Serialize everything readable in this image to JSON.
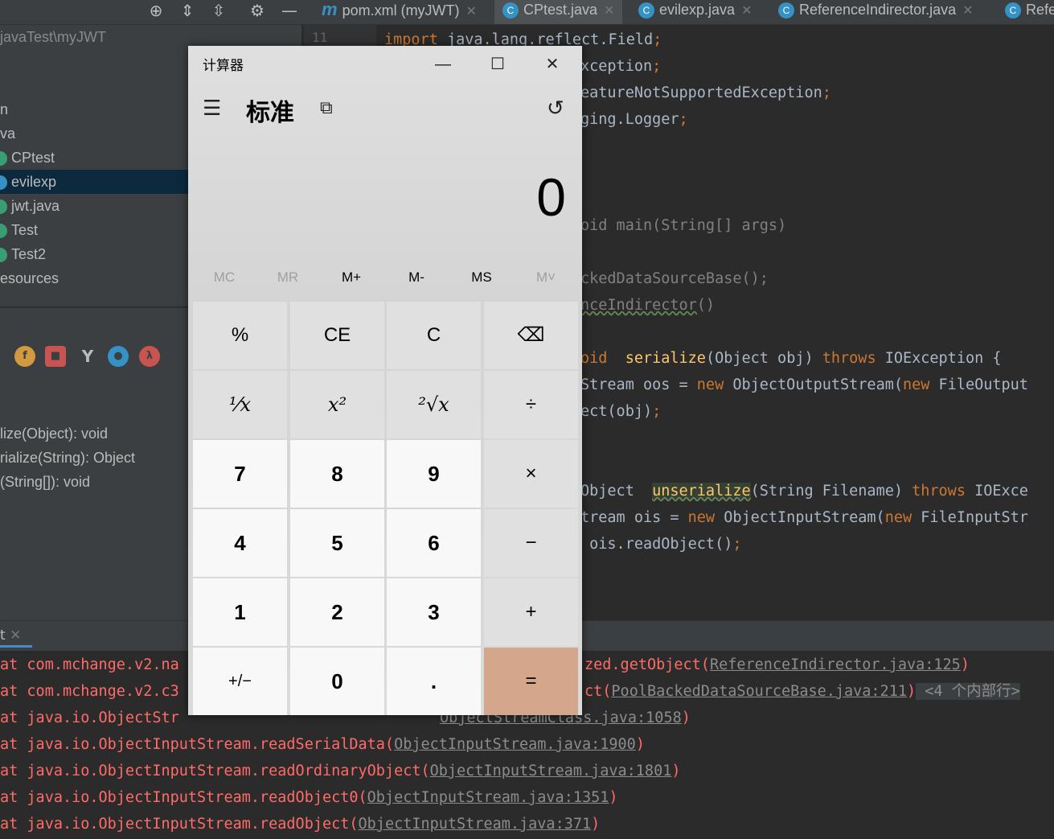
{
  "toolbar": {
    "icons": [
      "target-icon",
      "collapse-icon",
      "expand-icon",
      "gear-icon",
      "minimize-icon"
    ],
    "tabs": [
      {
        "label": "pom.xml (myJWT)",
        "icon": "m"
      },
      {
        "label": "CPtest.java",
        "icon": "C"
      },
      {
        "label": "evilexp.java",
        "icon": "C"
      },
      {
        "label": "ReferenceIndirector.java",
        "icon": "C"
      },
      {
        "label": "Refe",
        "icon": "C"
      }
    ]
  },
  "project": {
    "path": "javaTest\\myJWT",
    "items": [
      "n",
      "va",
      "CPtest",
      "evilexp",
      "jwt.java",
      "Test",
      "Test2",
      "esources"
    ]
  },
  "structure": {
    "items": [
      "lize(Object): void",
      "rialize(String): Object",
      "(String[]): void"
    ]
  },
  "editor": {
    "line_number": "11",
    "lines": [
      "import java.lang.reflect.Field;",
      "xception;",
      "eatureNotSupportedException;",
      "ging.Logger;",
      "",
      "",
      "oid main(String[] args)",
      "",
      "ckedDataSourceBase();",
      "nceIndirector()",
      "",
      "oid  serialize(Object obj) throws IOException {",
      "Stream oos = new ObjectOutputStream(new FileOutput",
      "ect(obj);",
      "",
      "",
      "Object  unserialize(String Filename) throws IOExce",
      "tream ois = new ObjectInputStream(new FileInputStr",
      " ois.readObject();"
    ]
  },
  "console": {
    "tab": "t",
    "lines": [
      {
        "pre": "at com.mchange.v2.na",
        "mid": "zed.getObject(",
        "link": "ReferenceIndirector.java:125",
        "post": ")"
      },
      {
        "pre": "at com.mchange.v2.c3",
        "mid": "ct(",
        "link": "PoolBackedDataSourceBase.java:211",
        "post": ")",
        "extra": " <4 个内部行>"
      },
      {
        "pre": "at java.io.ObjectStr",
        "mid": "",
        "link": "ObjectStreamClass.java:1058",
        "post": ")"
      },
      {
        "pre": "at java.io.ObjectInputStream.readSerialData(",
        "mid": "",
        "link": "ObjectInputStream.java:1900",
        "post": ")"
      },
      {
        "pre": "at java.io.ObjectInputStream.readOrdinaryObject(",
        "mid": "",
        "link": "ObjectInputStream.java:1801",
        "post": ")"
      },
      {
        "pre": "at java.io.ObjectInputStream.readObject0(",
        "mid": "",
        "link": "ObjectInputStream.java:1351",
        "post": ")"
      },
      {
        "pre": "at java.io.ObjectInputStream.readObject(",
        "mid": "",
        "link": "ObjectInputStream.java:371",
        "post": ")"
      }
    ]
  },
  "calculator": {
    "title": "计算器",
    "mode": "标准",
    "display": "0",
    "memory": [
      "MC",
      "MR",
      "M+",
      "M-",
      "MS",
      "M˅"
    ],
    "keys": [
      [
        "%",
        "CE",
        "C",
        "⌫"
      ],
      [
        "⅟x",
        "x²",
        "²√x",
        "÷"
      ],
      [
        "7",
        "8",
        "9",
        "×"
      ],
      [
        "4",
        "5",
        "6",
        "−"
      ],
      [
        "1",
        "2",
        "3",
        "+"
      ],
      [
        "+/−",
        "0",
        ".",
        "="
      ]
    ]
  }
}
